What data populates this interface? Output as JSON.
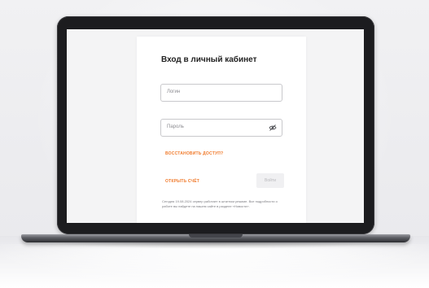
{
  "login_card": {
    "title": "Вход в личный кабинет",
    "login_placeholder": "Логин",
    "password_placeholder": "Пароль",
    "restore_link": "ВОССТАНОВИТЬ ДОСТУП?",
    "open_account_link": "ОТКРЫТЬ СЧЁТ",
    "login_button": "Войти",
    "notice": "Сегодня 19.08.2024 cервер работает в штатном режиме. Все подробности о работе вы найдете на нашем сайте в разделе «Новости»."
  },
  "icons": {
    "password_toggle": "eye-slash-icon"
  },
  "colors": {
    "accent": "#f07a2b",
    "laptop_bezel": "#1c1c1f",
    "screen_background": "#f4f4f5",
    "card_background": "#ffffff"
  }
}
